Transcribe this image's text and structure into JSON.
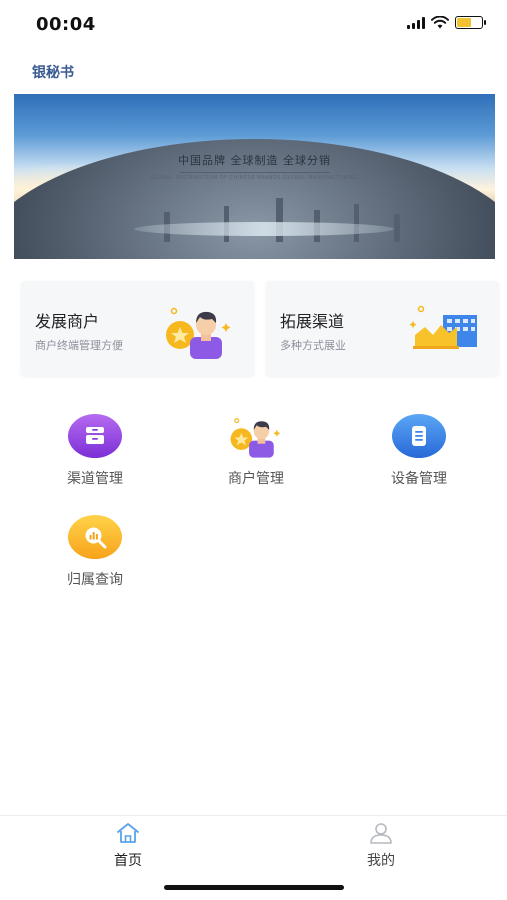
{
  "status_bar": {
    "time": "00:04",
    "icons": [
      "signal-icon",
      "wifi-icon",
      "battery-charging-icon"
    ]
  },
  "app": {
    "title": "银秘书"
  },
  "banner": {
    "headline": "中国品牌  全球制造  全球分销",
    "subline": "GLOBAL DISTRIBUTION OF CHINESE BRANDS GLOBAL MANUFACTURING"
  },
  "cards": [
    {
      "title": "发展商户",
      "subtitle": "商户终端管理方便",
      "icon": "merchant-person-icon"
    },
    {
      "title": "拓展渠道",
      "subtitle": "多种方式展业",
      "icon": "channel-building-icon"
    }
  ],
  "menu": [
    {
      "label": "渠道管理",
      "icon": "channel-manage-icon",
      "color": "#8a3ee0"
    },
    {
      "label": "商户管理",
      "icon": "merchant-manage-icon",
      "color": "#f5b41f"
    },
    {
      "label": "设备管理",
      "icon": "device-manage-icon",
      "color": "#3a85e8"
    },
    {
      "label": "归属查询",
      "icon": "ownership-query-icon",
      "color": "#f8b323"
    }
  ],
  "tab_bar": {
    "tabs": [
      {
        "label": "首页",
        "icon": "home-icon",
        "active": true
      },
      {
        "label": "我的",
        "icon": "user-icon",
        "active": false
      }
    ]
  },
  "colors": {
    "accent": "#3a5b92",
    "active_tab_icon": "#5aa2e8",
    "inactive_tab_icon": "#b5b9bf"
  }
}
